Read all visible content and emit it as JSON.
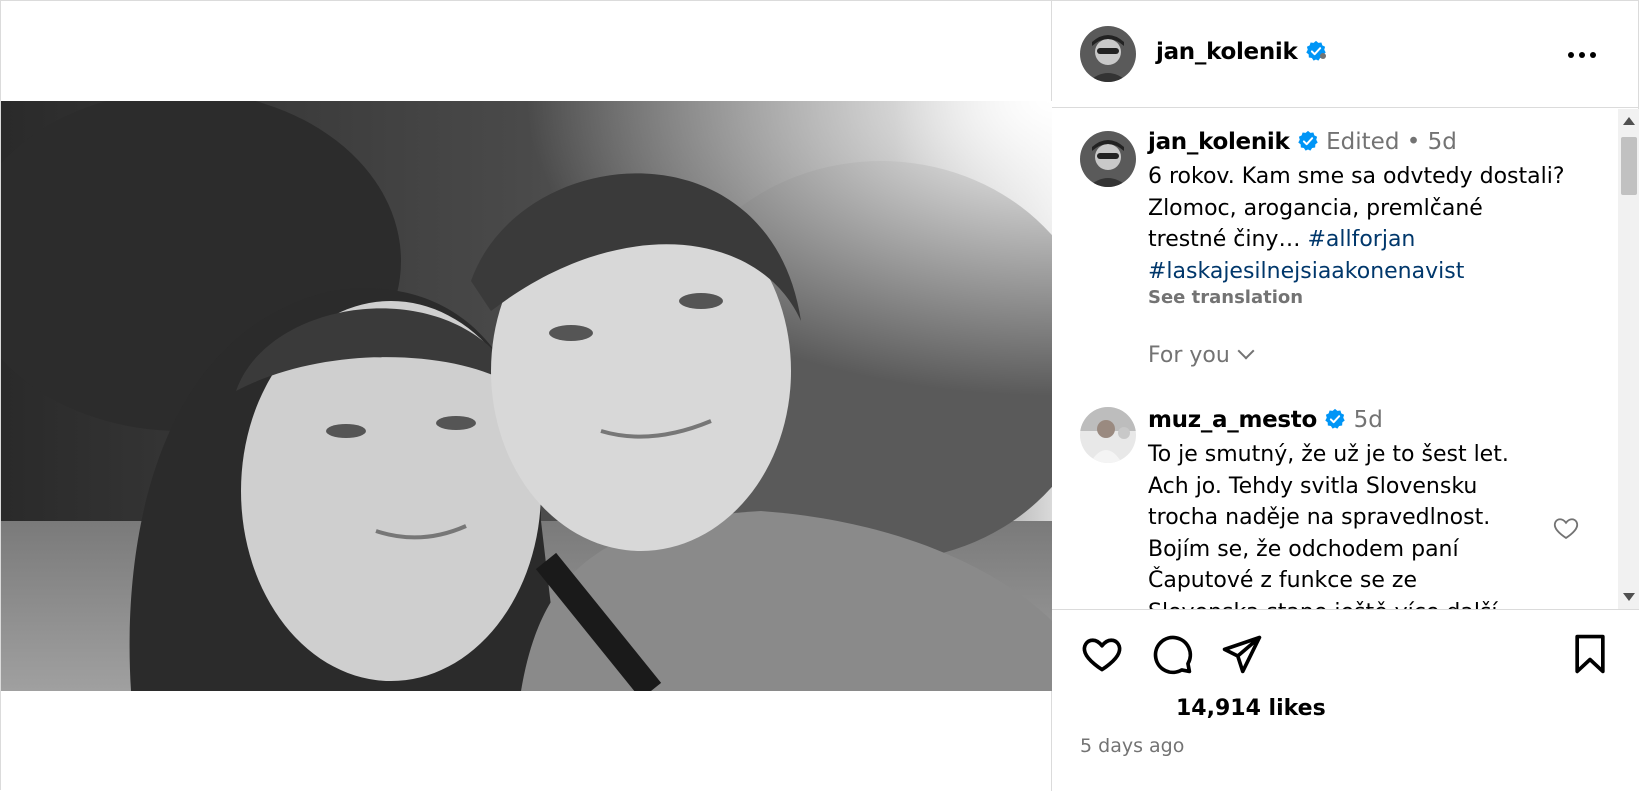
{
  "post": {
    "author": {
      "username": "jan_kolenik",
      "verified": true
    },
    "more_options": "more-options",
    "photo": {
      "description_icon": "photo"
    },
    "caption": {
      "username": "jan_kolenik",
      "edited": "Edited",
      "separator": "•",
      "age": "5d",
      "text": "6 rokov. Kam sme sa odvtedy dostali? Zlomoc, arogancia, premlčané trestné činy… ",
      "hashtag_1": "#allforjan",
      "hashtag_2": "#laskajesilnejsiaakonenavist",
      "see_translation": "See translation"
    },
    "for_you": "For you",
    "comment": {
      "username": "muz_a_mesto",
      "age": "5d",
      "text": "To je smutný, že už je to šest let. Ach jo. Tehdy svitla Slovensku trocha naděje na spravedlnost. Bojím se, že odchodem paní Čaputové z funkce se ze Slovenska stane ještě více další stát"
    },
    "likes": "14,914 likes",
    "posted": "5 days ago"
  },
  "colors": {
    "verified_blue": "#0095f6",
    "muted": "#737373",
    "hashtag": "#00376b",
    "border": "#dbdbdb"
  },
  "icons": [
    "heart-icon",
    "comment-icon",
    "share-icon",
    "bookmark-icon",
    "verified-icon",
    "more-icon",
    "chevron-down-icon"
  ]
}
